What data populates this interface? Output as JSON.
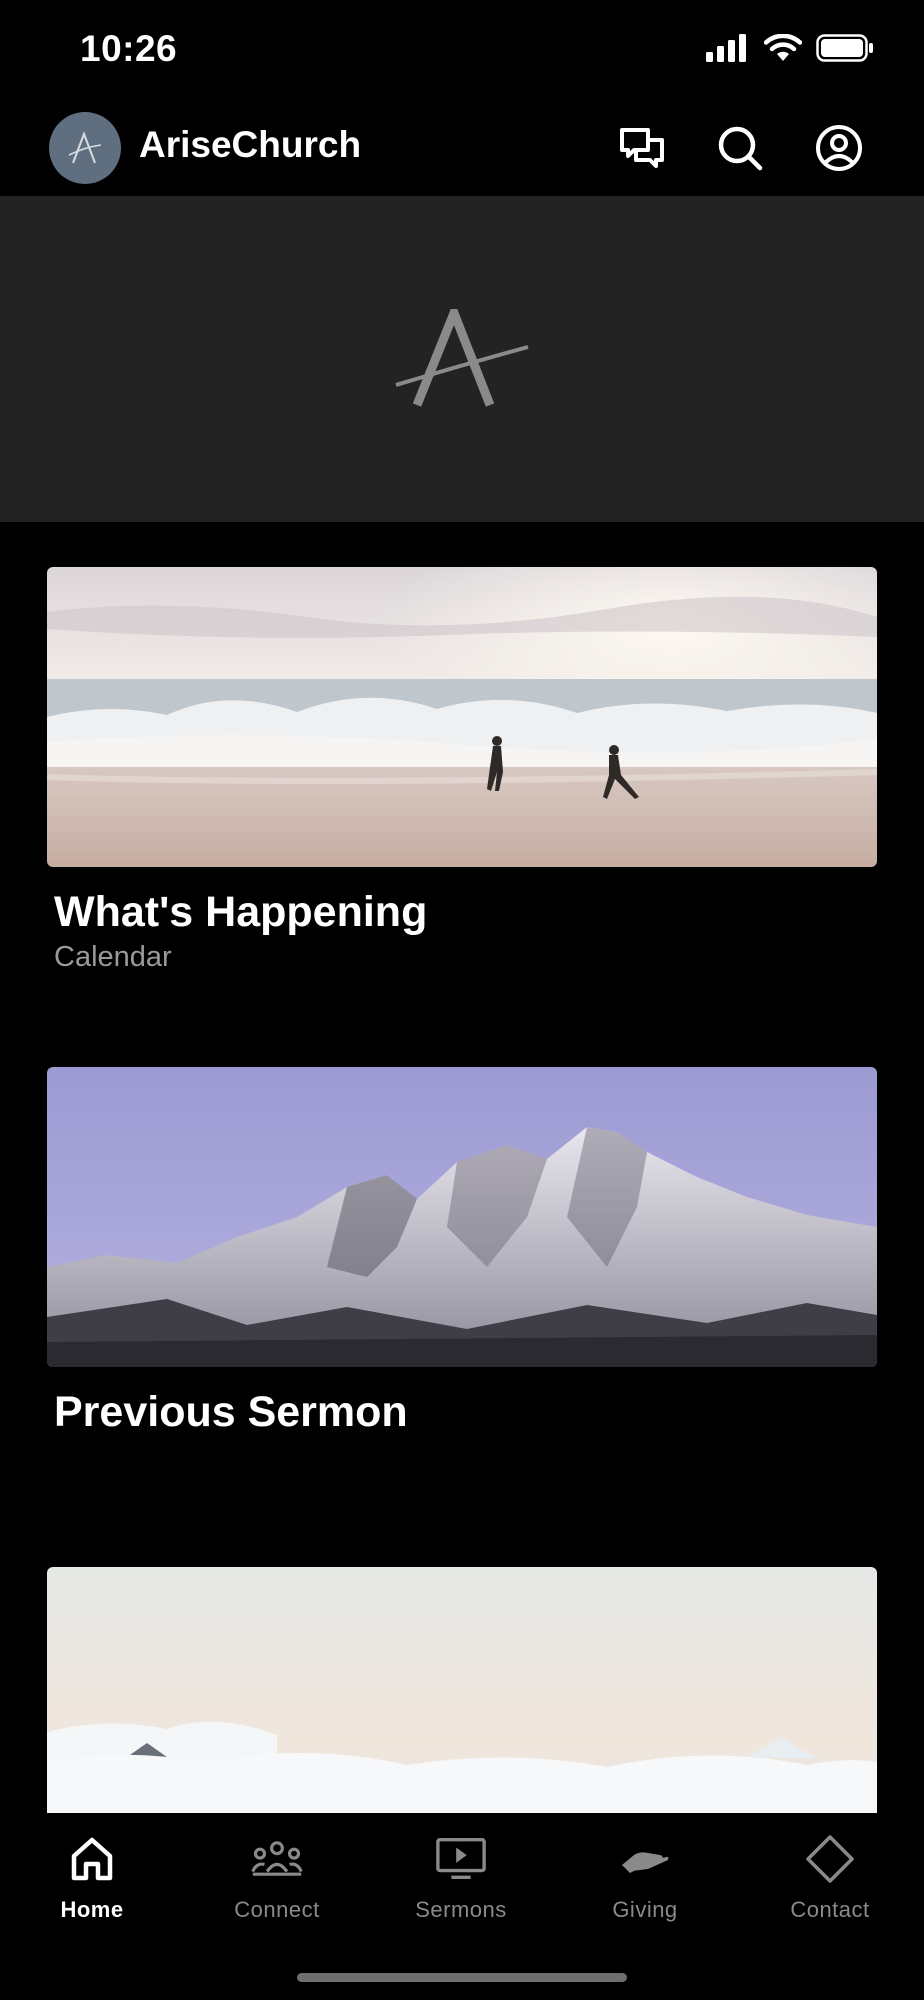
{
  "status": {
    "time": "10:26"
  },
  "header": {
    "title": "AriseChurch"
  },
  "cards": [
    {
      "title": "What's Happening",
      "subtitle": "Calendar",
      "image": "ocean-waves-runners-photo"
    },
    {
      "title": "Previous Sermon",
      "image": "snowy-mountain-range-photo"
    },
    {
      "image": "clouds-above-mountains-photo"
    }
  ],
  "tabs": [
    {
      "label": "Home",
      "icon": "home-icon",
      "active": true
    },
    {
      "label": "Connect",
      "icon": "people-icon"
    },
    {
      "label": "Sermons",
      "icon": "video-play-icon"
    },
    {
      "label": "Giving",
      "icon": "giving-hand-icon"
    },
    {
      "label": "Contact",
      "icon": "diamond-icon"
    }
  ],
  "colors": {
    "background": "#000000",
    "hero": "#232323",
    "inactive": "#8a8a8a",
    "avatar": "#5f6f80"
  }
}
